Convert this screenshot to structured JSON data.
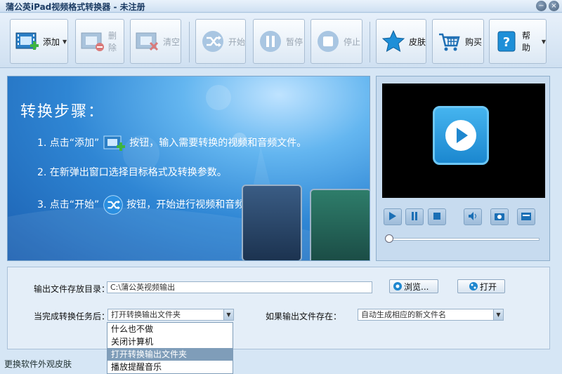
{
  "window": {
    "title": "蒲公英iPad视频格式转换器 - 未注册",
    "minimize_glyph": "−",
    "close_glyph": "×"
  },
  "toolbar": {
    "add": {
      "label": "添加",
      "icon": "film-add-icon"
    },
    "delete": {
      "label": "删除",
      "icon": "film-remove-icon"
    },
    "clear": {
      "label": "清空",
      "icon": "film-clear-icon"
    },
    "start": {
      "label": "开始",
      "icon": "shuffle-icon"
    },
    "pause": {
      "label": "暂停",
      "icon": "pause-icon"
    },
    "stop": {
      "label": "停止",
      "icon": "stop-icon"
    },
    "skin": {
      "label": "皮肤",
      "icon": "star-icon"
    },
    "buy": {
      "label": "购买",
      "icon": "cart-icon"
    },
    "help": {
      "label": "帮助",
      "icon": "help-icon"
    }
  },
  "banner": {
    "heading": "转换步骤：",
    "step1_a": "1. 点击“添加”",
    "step1_b": "按钮，输入需要转换的视频和音频文件。",
    "step2": "2. 在新弹出窗口选择目标格式及转换参数。",
    "step3_a": "3. 点击“开始”",
    "step3_b": "按钮，开始进行视频和音频文件的转换。"
  },
  "settings": {
    "output_dir_label": "输出文件存放目录：",
    "output_dir_value": "C:\\蒲公英视频输出",
    "browse_label": "浏览...",
    "open_label": "打开",
    "after_label": "当完成转换任务后：",
    "after_value": "打开转换输出文件夹",
    "exists_label": "如果输出文件存在：",
    "exists_value": "自动生成相应的新文件名"
  },
  "dropdown": {
    "options": [
      "什么也不做",
      "关闭计算机",
      "打开转换输出文件夹",
      "播放提醒音乐"
    ],
    "selected_index": 2
  },
  "status": {
    "text": "更换软件外观皮肤"
  },
  "colors": {
    "accent": "#1b87cf",
    "selection": "#7f9db9"
  }
}
